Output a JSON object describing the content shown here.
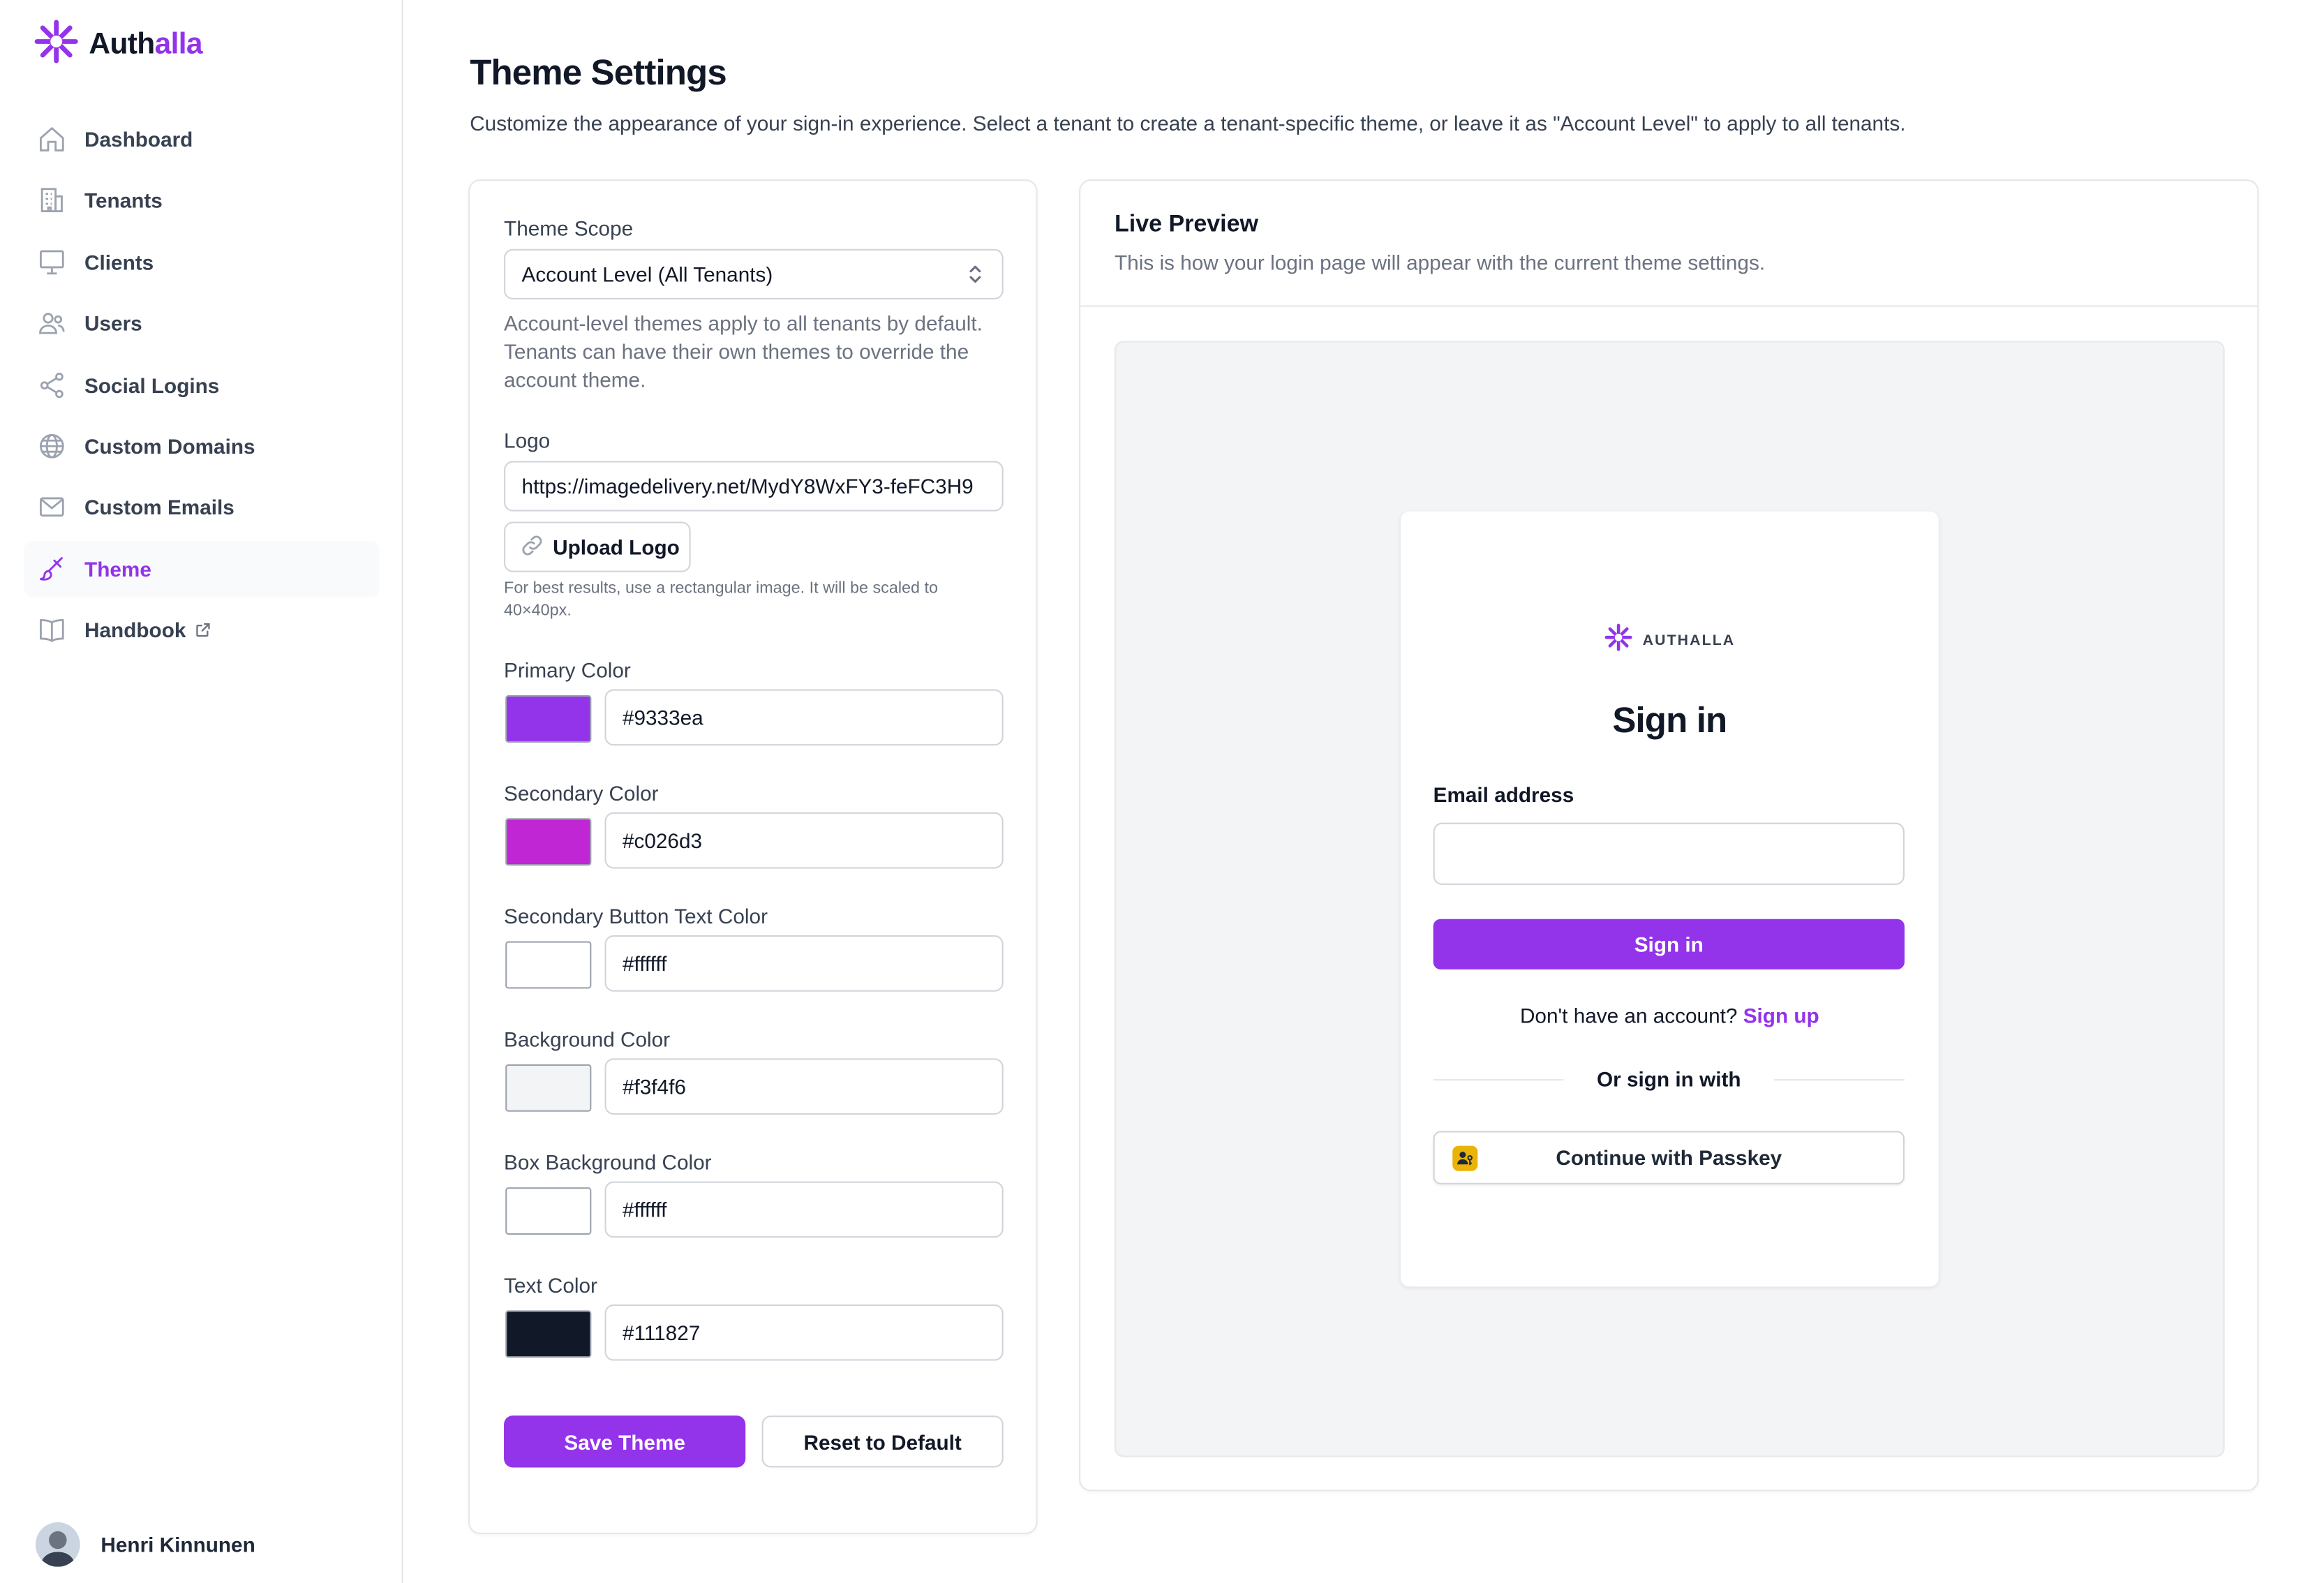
{
  "brand": {
    "name_part1": "Auth",
    "name_part2": "alla",
    "accent": "#9333ea"
  },
  "sidebar": {
    "items": [
      {
        "label": "Dashboard",
        "icon": "home-icon"
      },
      {
        "label": "Tenants",
        "icon": "building-icon"
      },
      {
        "label": "Clients",
        "icon": "monitor-icon"
      },
      {
        "label": "Users",
        "icon": "users-icon"
      },
      {
        "label": "Social Logins",
        "icon": "share-icon"
      },
      {
        "label": "Custom Domains",
        "icon": "globe-icon"
      },
      {
        "label": "Custom Emails",
        "icon": "mail-icon"
      },
      {
        "label": "Theme",
        "icon": "paintbrush-icon",
        "active": true
      },
      {
        "label": "Handbook",
        "icon": "book-icon",
        "external": true
      }
    ],
    "user": {
      "name": "Henri Kinnunen"
    }
  },
  "page": {
    "title": "Theme Settings",
    "subtitle": "Customize the appearance of your sign-in experience. Select a tenant to create a tenant-specific theme, or leave it as \"Account Level\" to apply to all tenants."
  },
  "settings": {
    "scope_label": "Theme Scope",
    "scope_value": "Account Level (All Tenants)",
    "scope_help": "Account-level themes apply to all tenants by default. Tenants can have their own themes to override the account theme.",
    "logo_label": "Logo",
    "logo_value": "https://imagedelivery.net/MydY8WxFY3-feFC3H9",
    "upload_label": "Upload Logo",
    "logo_help": "For best results, use a rectangular image. It will be scaled to 40×40px.",
    "colors": [
      {
        "label": "Primary Color",
        "value": "#9333ea"
      },
      {
        "label": "Secondary Color",
        "value": "#c026d3"
      },
      {
        "label": "Secondary Button Text Color",
        "value": "#ffffff"
      },
      {
        "label": "Background Color",
        "value": "#f3f4f6"
      },
      {
        "label": "Box Background Color",
        "value": "#ffffff"
      },
      {
        "label": "Text Color",
        "value": "#111827"
      }
    ],
    "save_label": "Save Theme",
    "reset_label": "Reset to Default"
  },
  "preview": {
    "title": "Live Preview",
    "subtitle": "This is how your login page will appear with the current theme settings.",
    "login": {
      "logo_text": "AUTHALLA",
      "title": "Sign in",
      "email_label": "Email address",
      "submit_label": "Sign in",
      "signup_prompt": "Don't have an account?",
      "signup_link": "Sign up",
      "or_text": "Or sign in with",
      "passkey_label": "Continue with Passkey"
    }
  }
}
